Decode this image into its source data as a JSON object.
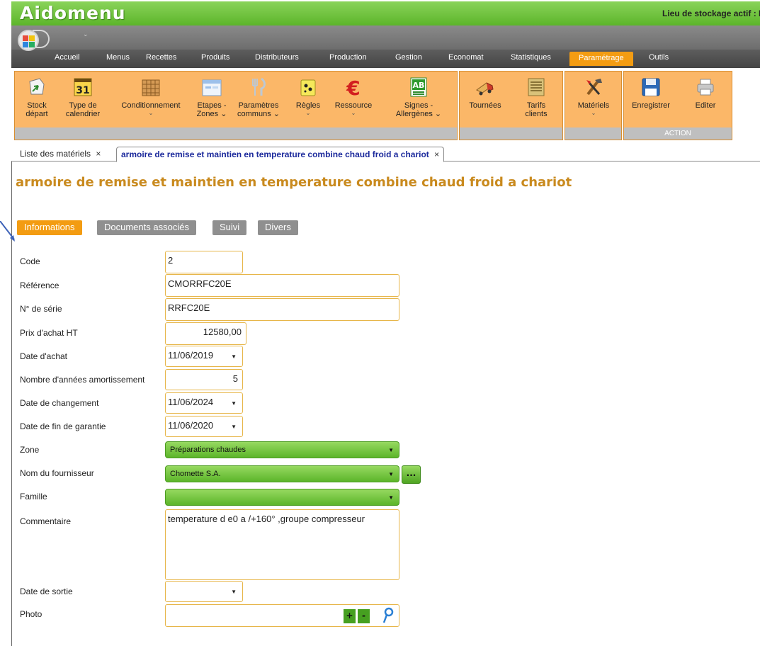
{
  "app": {
    "title": "Aidomenu",
    "storage_label": "Lieu de stockage actif : M"
  },
  "quickbar": {
    "menu_glyph": "⌄"
  },
  "colors": {
    "accent": "#f39c12",
    "green": "#5cb52a",
    "title_text": "#c98a1e",
    "tab_text": "#1c2a9c"
  },
  "ribbon_tabs": [
    "Accueil",
    "Menus",
    "Recettes",
    "Produits",
    "Distributeurs",
    "Production",
    "Gestion",
    "Economat",
    "Statistiques",
    "Paramétrage",
    "Outils"
  ],
  "active_ribbon_tab": "Paramétrage",
  "ribbon": {
    "stock_depart": {
      "line1": "Stock",
      "line2": "départ",
      "icon": "stock-icon"
    },
    "type_calendrier": {
      "line1": "Type de",
      "line2": "calendrier",
      "icon_text": "31",
      "icon": "calendar-icon"
    },
    "conditionnement": {
      "line1": "Conditionnement",
      "caret": "⌄",
      "icon": "crate-icon"
    },
    "etapes_zones": {
      "line1": "Etapes -",
      "line2": "Zones ⌄",
      "icon": "window-icon"
    },
    "parametres_communs": {
      "line1": "Paramètres",
      "line2": "communs ⌄",
      "icon": "cutlery-icon"
    },
    "regles": {
      "line1": "Règles",
      "caret": "⌄",
      "icon": "rules-icon"
    },
    "ressource": {
      "line1": "Ressource",
      "caret": "⌄",
      "icon_text": "€",
      "icon": "euro-icon"
    },
    "signes_allergenes": {
      "line1": "Signes -",
      "line2": "Allergènes ⌄",
      "icon_text": "AB",
      "icon": "organic-label-icon"
    },
    "tournees": {
      "line1": "Tournées",
      "icon": "truck-icon"
    },
    "tarifs_clients": {
      "line1": "Tarifs",
      "line2": "clients",
      "icon": "price-list-icon"
    },
    "materiels": {
      "line1": "Matériels",
      "caret": "⌄",
      "icon": "tools-icon"
    },
    "enregistrer": {
      "line1": "Enregistrer",
      "icon": "floppy-disk-icon"
    },
    "editer": {
      "line1": "Editer",
      "icon": "printer-icon"
    },
    "action_group_label": "ACTION"
  },
  "doc_tabs": {
    "list_tab": "Liste des matériels",
    "active_tab": "armoire de remise et maintien en temperature combine chaud froid  a chariot",
    "close_glyph": "×"
  },
  "page_title": "armoire de remise et maintien en temperature combine chaud froid  a chariot",
  "form_tabs": [
    "Informations",
    "Documents associés",
    "Suivi",
    "Divers"
  ],
  "form": {
    "code": {
      "label": "Code",
      "value": "2"
    },
    "reference": {
      "label": "Référence",
      "value": "CMORRFC20E"
    },
    "numero_serie": {
      "label": "N° de série",
      "value": "RRFC20E"
    },
    "prix_achat": {
      "label": "Prix d'achat HT",
      "value": "12580,00"
    },
    "date_achat": {
      "label": "Date d'achat",
      "value": "11/06/2019"
    },
    "annees_amortissement": {
      "label": "Nombre d'années amortissement",
      "value": "5"
    },
    "date_changement": {
      "label": "Date de changement",
      "value": "11/06/2024"
    },
    "date_fin_garantie": {
      "label": "Date de fin de garantie",
      "value": "11/06/2020"
    },
    "zone": {
      "label": "Zone",
      "value": "Préparations chaudes"
    },
    "fournisseur": {
      "label": "Nom du fournisseur",
      "value": "Chomette S.A.",
      "more_button": "..."
    },
    "famille": {
      "label": "Famille",
      "value": ""
    },
    "commentaire": {
      "label": "Commentaire",
      "value": "temperature d e0 a /+160°    ,groupe compresseur"
    },
    "date_sortie": {
      "label": "Date de sortie",
      "value": ""
    },
    "photo": {
      "label": "Photo",
      "add": "+",
      "remove": "-"
    }
  },
  "dropdown_glyph": "▼"
}
